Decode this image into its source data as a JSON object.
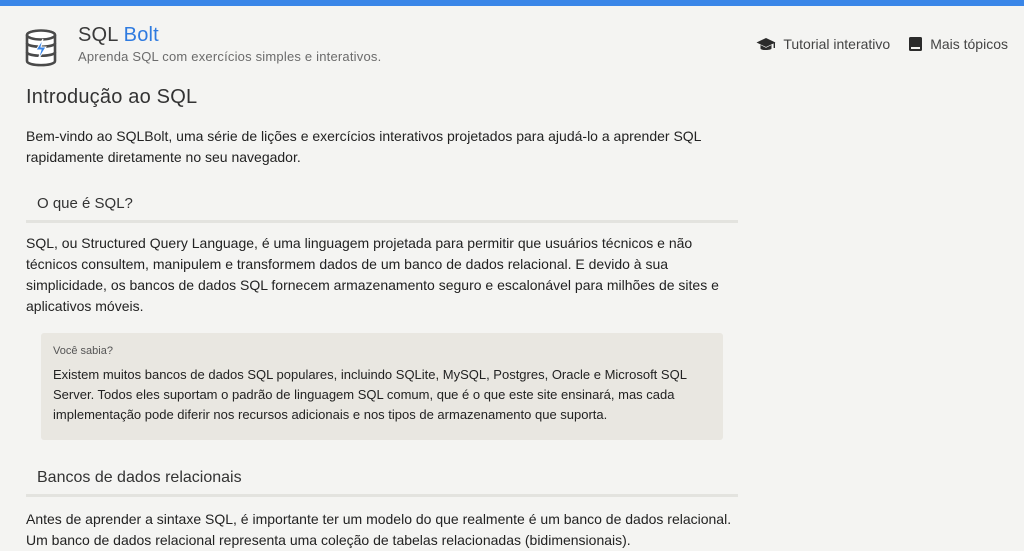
{
  "header": {
    "brand_main": "SQL",
    "brand_accent": "Bolt",
    "tagline": "Aprenda SQL com exercícios simples e interativos.",
    "nav": [
      {
        "label": "Tutorial interativo",
        "icon": "graduation-cap-icon"
      },
      {
        "label": "Mais tópicos",
        "icon": "book-icon"
      }
    ]
  },
  "colors": {
    "accent": "#3a86e8",
    "brand_accent": "#2f7be0",
    "background": "#f4f4f2",
    "callout_bg": "#e9e7e1"
  },
  "main": {
    "title": "Introdução ao SQL",
    "intro": "Bem-vindo ao SQLBolt, uma série de lições e exercícios interativos projetados para ajudá-lo a aprender SQL rapidamente diretamente no seu navegador.",
    "section1": {
      "heading": "O que é SQL?",
      "text": "SQL, ou Structured Query Language, é uma linguagem projetada para permitir que usuários técnicos e não técnicos consultem, manipulem e transformem dados de um banco de dados relacional. E devido à sua simplicidade, os bancos de dados SQL fornecem armazenamento seguro e escalonável para milhões de sites e aplicativos móveis."
    },
    "callout": {
      "title": "Você sabia?",
      "text": "Existem muitos bancos de dados SQL populares, incluindo SQLite, MySQL, Postgres, Oracle e Microsoft SQL Server. Todos eles suportam o padrão de linguagem SQL comum, que é o que este site ensinará, mas cada implementação pode diferir nos recursos adicionais e nos tipos de armazenamento que suporta."
    },
    "section2": {
      "heading": "Bancos de dados relacionais",
      "text": "Antes de aprender a sintaxe SQL, é importante ter um modelo do que realmente é um banco de dados relacional. Um banco de dados relacional representa uma coleção de tabelas relacionadas (bidimensionais)."
    }
  }
}
